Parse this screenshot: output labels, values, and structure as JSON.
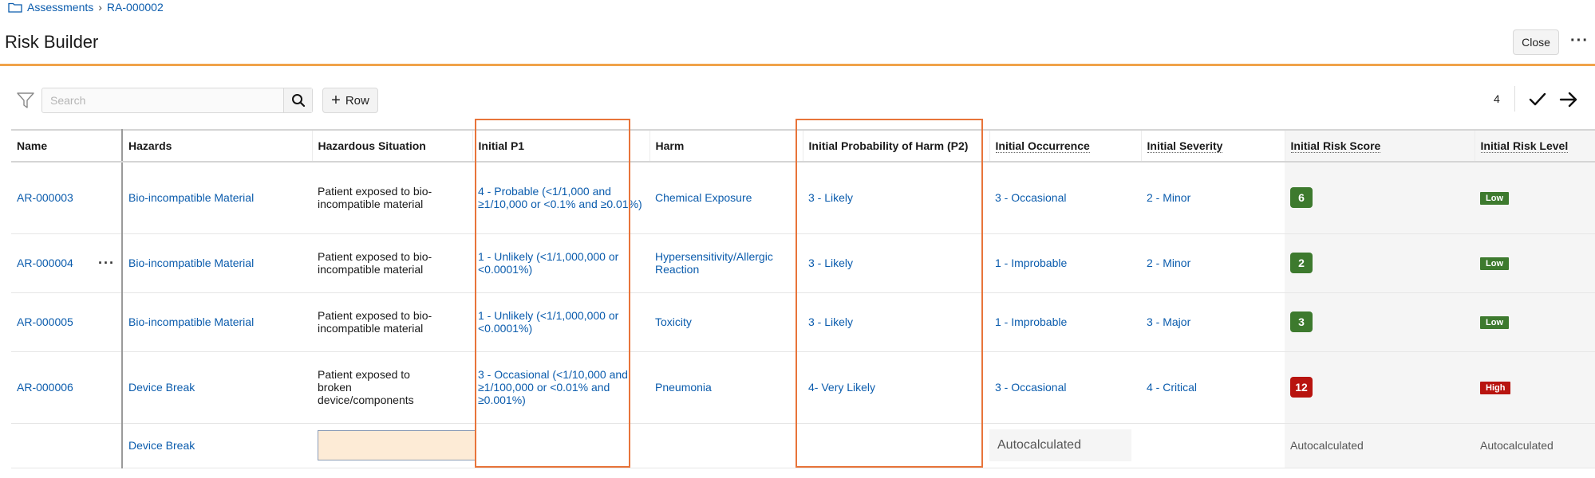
{
  "breadcrumb": {
    "root": "Assessments",
    "current": "RA-000002"
  },
  "header": {
    "title": "Risk Builder",
    "close_label": "Close",
    "more_label": "···"
  },
  "toolbar": {
    "search_placeholder": "Search",
    "add_row_label": "Row",
    "record_count": "4"
  },
  "columns": {
    "name": "Name",
    "hazards": "Hazards",
    "hazardous_situation": "Hazardous Situation",
    "initial_p1": "Initial P1",
    "harm": "Harm",
    "initial_p2": "Initial Probability of Harm (P2)",
    "occurrence": "Initial Occurrence",
    "severity": "Initial Severity",
    "risk_score": "Initial Risk Score",
    "risk_level": "Initial Risk Level"
  },
  "rows": [
    {
      "name": "AR-000003",
      "hazard": "Bio-incompatible Material",
      "situation": "Patient exposed to bio-incompatible material",
      "p1": "4 - Probable (<1/1,000 and ≥1/10,000 or <0.1% and ≥0.01%)",
      "harm": "Chemical Exposure",
      "p2": "3 - Likely",
      "occurrence": "3 - Occasional",
      "severity": "2 - Minor",
      "score": "6",
      "level": "Low"
    },
    {
      "name": "AR-000004",
      "hazard": "Bio-incompatible Material",
      "situation": "Patient exposed to bio-incompatible material",
      "p1": "1 - Unlikely (<1/1,000,000 or <0.0001%)",
      "harm": "Hypersensitivity/Allergic Reaction",
      "p2": "3 - Likely",
      "occurrence": "1 - Improbable",
      "severity": "2 - Minor",
      "score": "2",
      "level": "Low"
    },
    {
      "name": "AR-000005",
      "hazard": "Bio-incompatible Material",
      "situation": "Patient exposed to bio-incompatible material",
      "p1": "1 - Unlikely (<1/1,000,000 or <0.0001%)",
      "harm": "Toxicity",
      "p2": "3 - Likely",
      "occurrence": "1 - Improbable",
      "severity": "3 - Major",
      "score": "3",
      "level": "Low"
    },
    {
      "name": "AR-000006",
      "hazard": "Device Break",
      "situation": "Patient exposed to broken device/components",
      "p1": "3 - Occasional (<1/10,000 and ≥1/100,000 or <0.01% and ≥0.001%)",
      "harm": "Pneumonia",
      "p2": "4- Very Likely",
      "occurrence": "3 - Occasional",
      "severity": "4 - Critical",
      "score": "12",
      "level": "High"
    }
  ],
  "new_row": {
    "hazard": "Device Break",
    "occurrence": "Autocalculated",
    "risk_score": "Autocalculated",
    "risk_level": "Autocalculated"
  },
  "colors": {
    "accent": "#f0a34a",
    "link": "#0b5cad",
    "low": "#3d7a2e",
    "high": "#b8140f",
    "highlight": "#e8743a"
  },
  "icons": {
    "folder": "folder-icon",
    "filter": "filter-icon",
    "search": "search-icon",
    "check": "check-icon",
    "arrow": "arrow-right-icon",
    "more": "more-horizontal-icon"
  }
}
